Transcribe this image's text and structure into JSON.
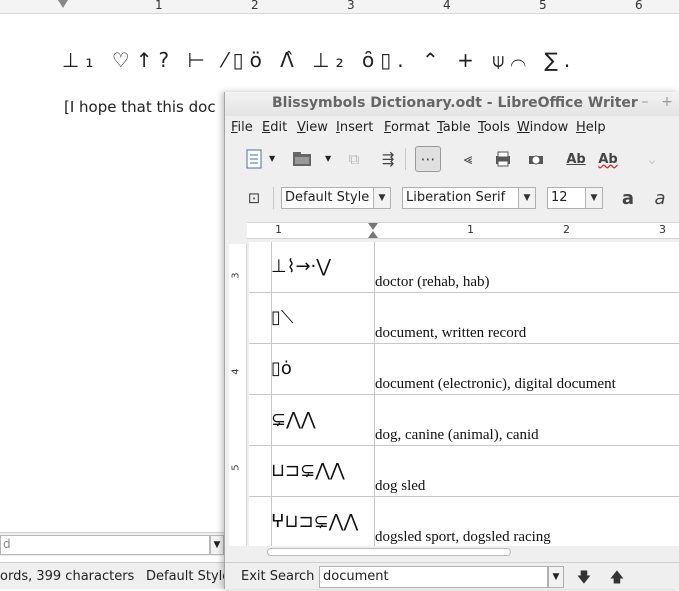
{
  "background_window": {
    "ruler_numbers": [
      "1",
      "2",
      "3",
      "4",
      "5",
      "6"
    ],
    "bliss_symbols": "⊥₁ ♡↑? ⊢ ⁄▯ö Λ̂ ⊥₂ ȏ▯. ⌃ + ⍦⌒ ∑.",
    "body_text": "[I hope that this doc",
    "find_input_value": "d",
    "status_words": "ords, 399 characters",
    "status_style": "Default Style"
  },
  "writer_window": {
    "title": "Blissymbols Dictionary.odt - LibreOffice Writer",
    "window_buttons": {
      "minimize": "–",
      "maximize": "+"
    },
    "menu": [
      {
        "accel": "F",
        "rest": "ile"
      },
      {
        "accel": "E",
        "rest": "dit"
      },
      {
        "accel": "V",
        "rest": "iew"
      },
      {
        "accel": "I",
        "rest": "nsert"
      },
      {
        "accel": "F",
        "rest": "ormat"
      },
      {
        "accel": "T",
        "rest": "able"
      },
      {
        "accel": "T",
        "rest": "ools"
      },
      {
        "accel": "W",
        "rest": "indow"
      },
      {
        "accel": "H",
        "rest": "elp"
      }
    ],
    "toolbar_icons": [
      "document-icon",
      "open-folder-icon",
      "export-pdf-icon",
      "print-icon",
      "print-preview-icon",
      "spellcheck-icon",
      "autospell-icon"
    ],
    "paragraph_style": "Default Style",
    "font_name": "Liberation Serif",
    "font_size": "12",
    "bold_glyph": "a",
    "italic_glyph": "a",
    "ruler_numbers": [
      "1",
      "1",
      "2",
      "3"
    ],
    "vruler_numbers": [
      "3",
      "4",
      "5"
    ],
    "entries": [
      {
        "symbol": "⊥⌇→·⋁",
        "text": "doctor (rehab, hab)"
      },
      {
        "symbol": "▯⟍",
        "text": "document, written record"
      },
      {
        "symbol": "▯ȯ",
        "text": "document (electronic), digital document"
      },
      {
        "symbol": "⊊⋀⋀",
        "text": "dog, canine (animal), canid"
      },
      {
        "symbol": "⊔⊐⊊⋀⋀",
        "text": "dog sled"
      },
      {
        "symbol": "ⵖ⊔⊐⊊⋀⋀",
        "text": "dogsled sport, dogsled racing"
      }
    ],
    "find_bar": {
      "exit_label": "Exit Search",
      "search_value": "document"
    }
  }
}
